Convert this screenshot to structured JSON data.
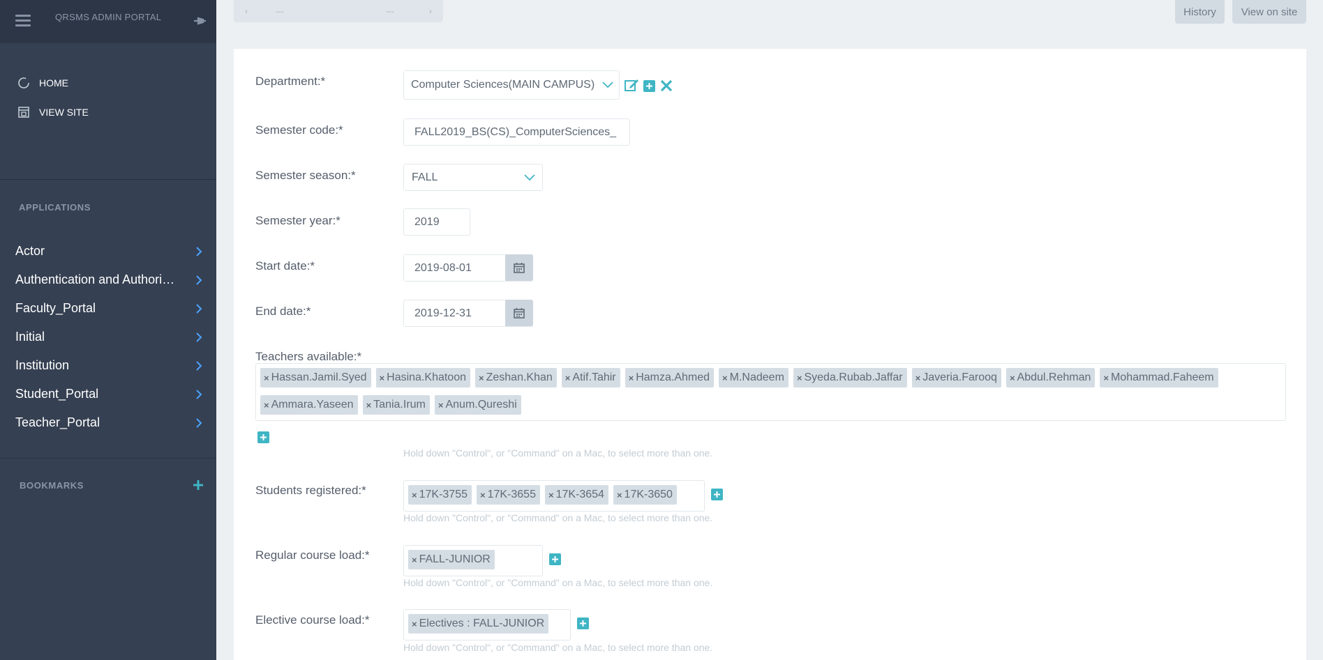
{
  "sidebar": {
    "portal_title": "QRSMS ADMIN PORTAL",
    "quick_links": [
      {
        "label": "HOME",
        "icon": "circle-icon"
      },
      {
        "label": "VIEW SITE",
        "icon": "view-site-icon"
      }
    ],
    "applications_title": "APPLICATIONS",
    "apps": [
      {
        "label": "Actor"
      },
      {
        "label": "Authentication and Authoriz…"
      },
      {
        "label": "Faculty_Portal"
      },
      {
        "label": "Initial"
      },
      {
        "label": "Institution"
      },
      {
        "label": "Student_Portal"
      },
      {
        "label": "Teacher_Portal"
      }
    ],
    "bookmarks_title": "BOOKMARKS"
  },
  "topbar": {
    "pager_prev": "‹",
    "pager_left": "---",
    "pager_right": "---",
    "pager_next": "›",
    "history_label": "History",
    "view_on_site_label": "View on site"
  },
  "form": {
    "department": {
      "label": "Department:*",
      "value": "Computer Sciences(MAIN CAMPUS)"
    },
    "semester_code": {
      "label": "Semester code:*",
      "value": "FALL2019_BS(CS)_ComputerSciences_"
    },
    "semester_season": {
      "label": "Semester season:*",
      "value": "FALL"
    },
    "semester_year": {
      "label": "Semester year:*",
      "value": "2019"
    },
    "start_date": {
      "label": "Start date:*",
      "value": "2019-08-01"
    },
    "end_date": {
      "label": "End date:*",
      "value": "2019-12-31"
    },
    "teachers": {
      "label": "Teachers available:*",
      "row1": [
        "Hassan.Jamil.Syed",
        "Hasina.Khatoon",
        "Zeshan.Khan",
        "Atif.Tahir",
        "Hamza.Ahmed",
        "M.Nadeem",
        "Syeda.Rubab.Jaffar",
        "Javeria.Farooq",
        "Abdul.Rehman",
        "Mohammad.Faheem"
      ],
      "row2": [
        "Ammara.Yaseen",
        "Tania.Irum",
        "Anum.Qureshi"
      ],
      "help": "Hold down \"Control\", or \"Command\" on a Mac, to select more than one."
    },
    "students": {
      "label": "Students registered:*",
      "tags": [
        "17K-3755",
        "17K-3655",
        "17K-3654",
        "17K-3650"
      ],
      "help": "Hold down \"Control\", or \"Command\" on a Mac, to select more than one."
    },
    "regular_load": {
      "label": "Regular course load:*",
      "tags": [
        "FALL-JUNIOR"
      ],
      "help": "Hold down \"Control\", or \"Command\" on a Mac, to select more than one."
    },
    "elective_load": {
      "label": "Elective course load:*",
      "tags": [
        "Electives : FALL-JUNIOR"
      ],
      "help": "Hold down \"Control\", or \"Command\" on a Mac, to select more than one."
    },
    "tag_remove_glyph": "×"
  },
  "colors": {
    "sidebar_bg": "#354052",
    "accent": "#3fb5c4",
    "link_chevron": "#4da3ff"
  }
}
